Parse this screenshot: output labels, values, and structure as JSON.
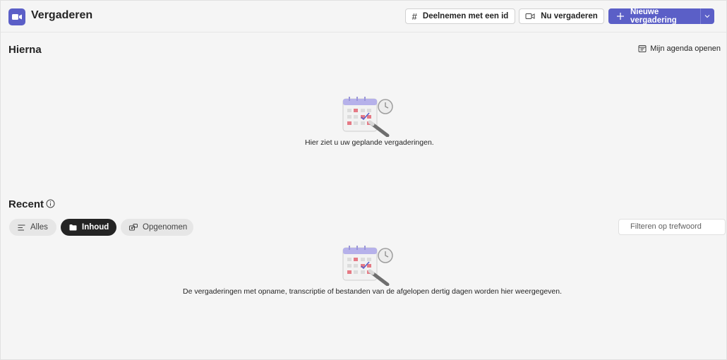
{
  "header": {
    "title": "Vergaderen",
    "app_icon": "video-camera-icon",
    "join_by_id_label": "Deelnemen met een id",
    "meet_now_label": "Nu vergaderen",
    "new_meeting_label": "Nieuwe vergadering"
  },
  "upcoming": {
    "title": "Hierna",
    "open_calendar_label": "Mijn agenda openen",
    "empty_text": "Hier ziet u uw geplande vergaderingen."
  },
  "recent": {
    "title": "Recent",
    "filters": [
      {
        "label": "Alles",
        "icon": "list-icon",
        "active": false
      },
      {
        "label": "Inhoud",
        "icon": "folder-icon",
        "active": true
      },
      {
        "label": "Opgenomen",
        "icon": "recording-icon",
        "active": false
      }
    ],
    "search_placeholder": "Filteren op trefwoord",
    "empty_text": "De vergaderingen met opname, transcriptie of bestanden van de afgelopen dertig dagen worden hier weergegeven."
  },
  "colors": {
    "brand": "#5b5fc7",
    "background": "#f5f5f5",
    "active_pill": "#242424"
  }
}
